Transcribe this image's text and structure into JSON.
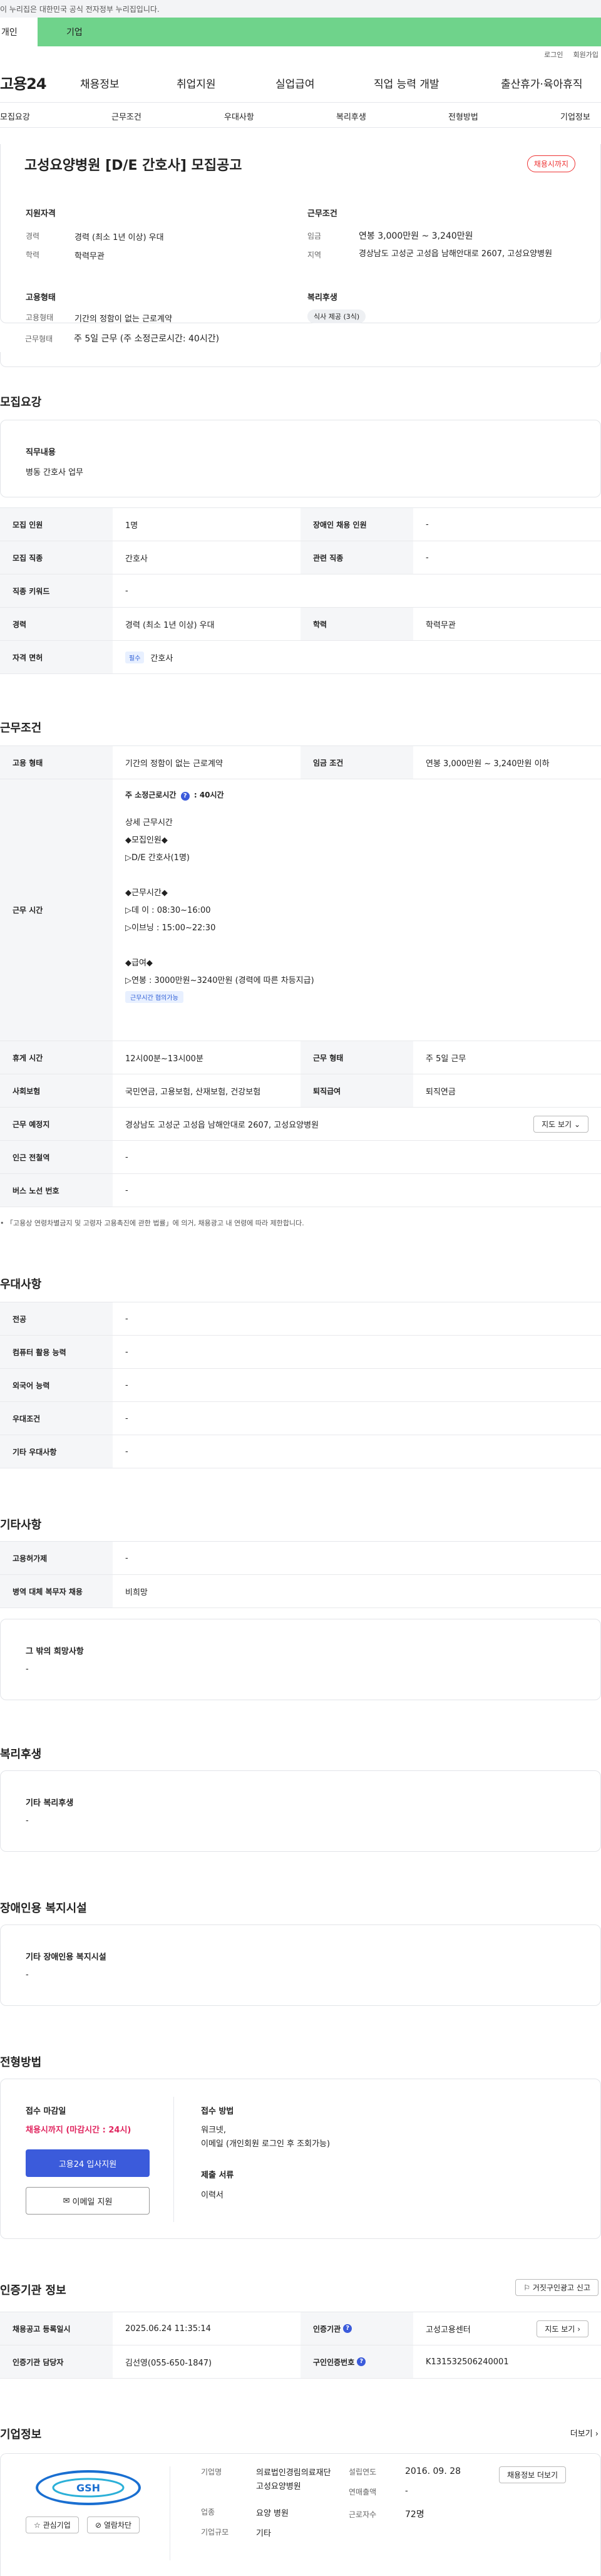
{
  "gov_notice": "이 누리집은 대한민국 공식 전자정부 누리집입니다.",
  "segments": {
    "personal": "개인",
    "corporate": "기업"
  },
  "util": {
    "login": "로그인",
    "join": "회원가입"
  },
  "logo": "고용24",
  "gnb": [
    "채용정보",
    "취업지원",
    "실업급여",
    "직업 능력 개발",
    "출산휴가·육아휴직"
  ],
  "subnav": [
    "모집요강",
    "근무조건",
    "우대사항",
    "복리후생",
    "전형방법",
    "기업정보"
  ],
  "summary": {
    "title": "고성요양병원 [D/E 간호사] 모집공고",
    "status_badge": "채용시까지",
    "qual_heading": "지원자격",
    "qual_career_label": "경력",
    "qual_career": "경력 (최소 1년 이상) 우대",
    "qual_edu_label": "학력",
    "qual_edu": "학력무관",
    "cond_heading": "근무조건",
    "cond_wage_label": "임금",
    "cond_wage": "연봉 3,000만원 ~ 3,240만원",
    "cond_region_label": "지역",
    "cond_region": "경상남도 고성군 고성읍 남해안대로 2607, 고성요양병원",
    "emp_heading": "고용형태",
    "emp_type_label": "고용형태",
    "emp_type": "기간의 정함이 없는 근로계약",
    "emp_hours_label": "근무형태",
    "emp_hours": "주 5일 근무 (주 소정근로시간: 40시간)",
    "welfare_heading": "복리후생",
    "welfare_tag": "식사 제공 (3식)"
  },
  "recruit": {
    "title": "모집요강",
    "duty_label": "직무내용",
    "duty": "병동 간호사 업무",
    "rows": [
      {
        "th": "모집 인원",
        "td": "1명",
        "th2": "장애인 채용 인원",
        "td2": "-"
      },
      {
        "th": "모집 직종",
        "td": "간호사",
        "th2": "관련 직종",
        "td2": "-"
      },
      {
        "th": "직종 키워드",
        "td": "-"
      },
      {
        "th": "경력",
        "td": "경력 (최소 1년 이상) 우대",
        "th2": "학력",
        "td2": "학력무관"
      },
      {
        "th": "자격 면허",
        "td_tag": "필수",
        "td": "간호사"
      }
    ]
  },
  "work": {
    "title": "근무조건",
    "emp_type_th": "고용 형태",
    "emp_type": "기간의 정함이 없는 근로계약",
    "wage_th": "임금 조건",
    "wage": "연봉 3,000만원 ~ 3,240만원 이하",
    "hours_th": "근무 시간",
    "hours_head": "주 소정근로시간",
    "hours_value": "40시간",
    "hours_lines": [
      "상세 근무시간",
      "◆모집인원◆",
      "▷D/E 간호사(1명)",
      "",
      "◆근무시간◆",
      "▷데    이 : 08:30~16:00",
      "▷이브닝 : 15:00~22:30",
      "",
      "◆급여◆",
      "▷연봉 : 3000만원~3240만원 (경력에 따른 차등지급)"
    ],
    "hours_tag": "근무시간 협의가능",
    "rest_th": "휴게 시간",
    "rest": "12시00분~13시00분",
    "form_th": "근무 형태",
    "form": "주 5일 근무",
    "ins_th": "사회보험",
    "ins": "국민연금, 고용보험, 산재보험, 건강보험",
    "sev_th": "퇴직급여",
    "sev": "퇴직연금",
    "place_th": "근무 예정지",
    "place": "경상남도 고성군 고성읍 남해안대로 2607, 고성요양병원",
    "map_btn": "지도 보기",
    "subway_th": "인근 전철역",
    "subway": "-",
    "bus_th": "버스 노선 번호",
    "bus": "-",
    "note": "「고용상 연령차별금지 및 고령자 고용촉진에 관한 법률」에 의거, 채용광고 내 연령에 따라 제한합니다."
  },
  "pref": {
    "title": "우대사항",
    "rows": [
      {
        "th": "전공",
        "td": "-"
      },
      {
        "th": "컴퓨터 활용 능력",
        "td": "-"
      },
      {
        "th": "외국어 능력",
        "td": "-"
      },
      {
        "th": "우대조건",
        "td": "-"
      },
      {
        "th": "기타 우대사항",
        "td": "-"
      }
    ]
  },
  "etc": {
    "title": "기타사항",
    "rows": [
      {
        "th": "고용허가제",
        "td": "-"
      },
      {
        "th": "병역 대체 복무자 채용",
        "td": "비희망"
      }
    ],
    "other_label": "그 밖의 희망사항",
    "other": "-"
  },
  "welfare": {
    "title": "복리후생",
    "label": "기타 복리후생",
    "value": "-"
  },
  "disabled": {
    "title": "장애인용 복지시설",
    "label": "기타 장애인용 복지시설",
    "value": "-"
  },
  "screen": {
    "title": "전형방법",
    "deadline_label": "접수 마감일",
    "deadline": "채용시까지 (마감시간 : 24시)",
    "apply_btn": "고용24 입사지원",
    "email_btn": "이메일 지원",
    "method_label": "접수 방법",
    "method1": "워크넷,",
    "method2": "이메일 (개인회원 로그인 후 조회가능)",
    "docs_label": "제출 서류",
    "docs": "이력서"
  },
  "cert": {
    "title": "인증기관 정보",
    "report_btn": "거짓구인광고 신고",
    "reg_th": "채용공고 등록일시",
    "reg": "2025.06.24 11:35:14",
    "org_th": "인증기관",
    "org": "고성고용센터",
    "map_btn": "지도 보기",
    "mgr_th": "인증기관 담당자",
    "mgr": "김선영(055-650-1847)",
    "no_th": "구인인증번호",
    "no": "K131532506240001"
  },
  "company": {
    "title": "기업정보",
    "more": "더보기",
    "name_label": "기업명",
    "name": "의료법인경림의료재단고성요양병원",
    "biz_label": "업종",
    "biz": "요양 병원",
    "size_label": "기업규모",
    "size": "기타",
    "est_label": "설립연도",
    "est": "2016. 09. 28",
    "sales_label": "연매출액",
    "sales": "-",
    "staff_label": "근로자수",
    "staff": "72명",
    "jobs_btn": "채용정보 더보기",
    "fav_btn": "관심기업",
    "block_btn": "열람차단"
  }
}
